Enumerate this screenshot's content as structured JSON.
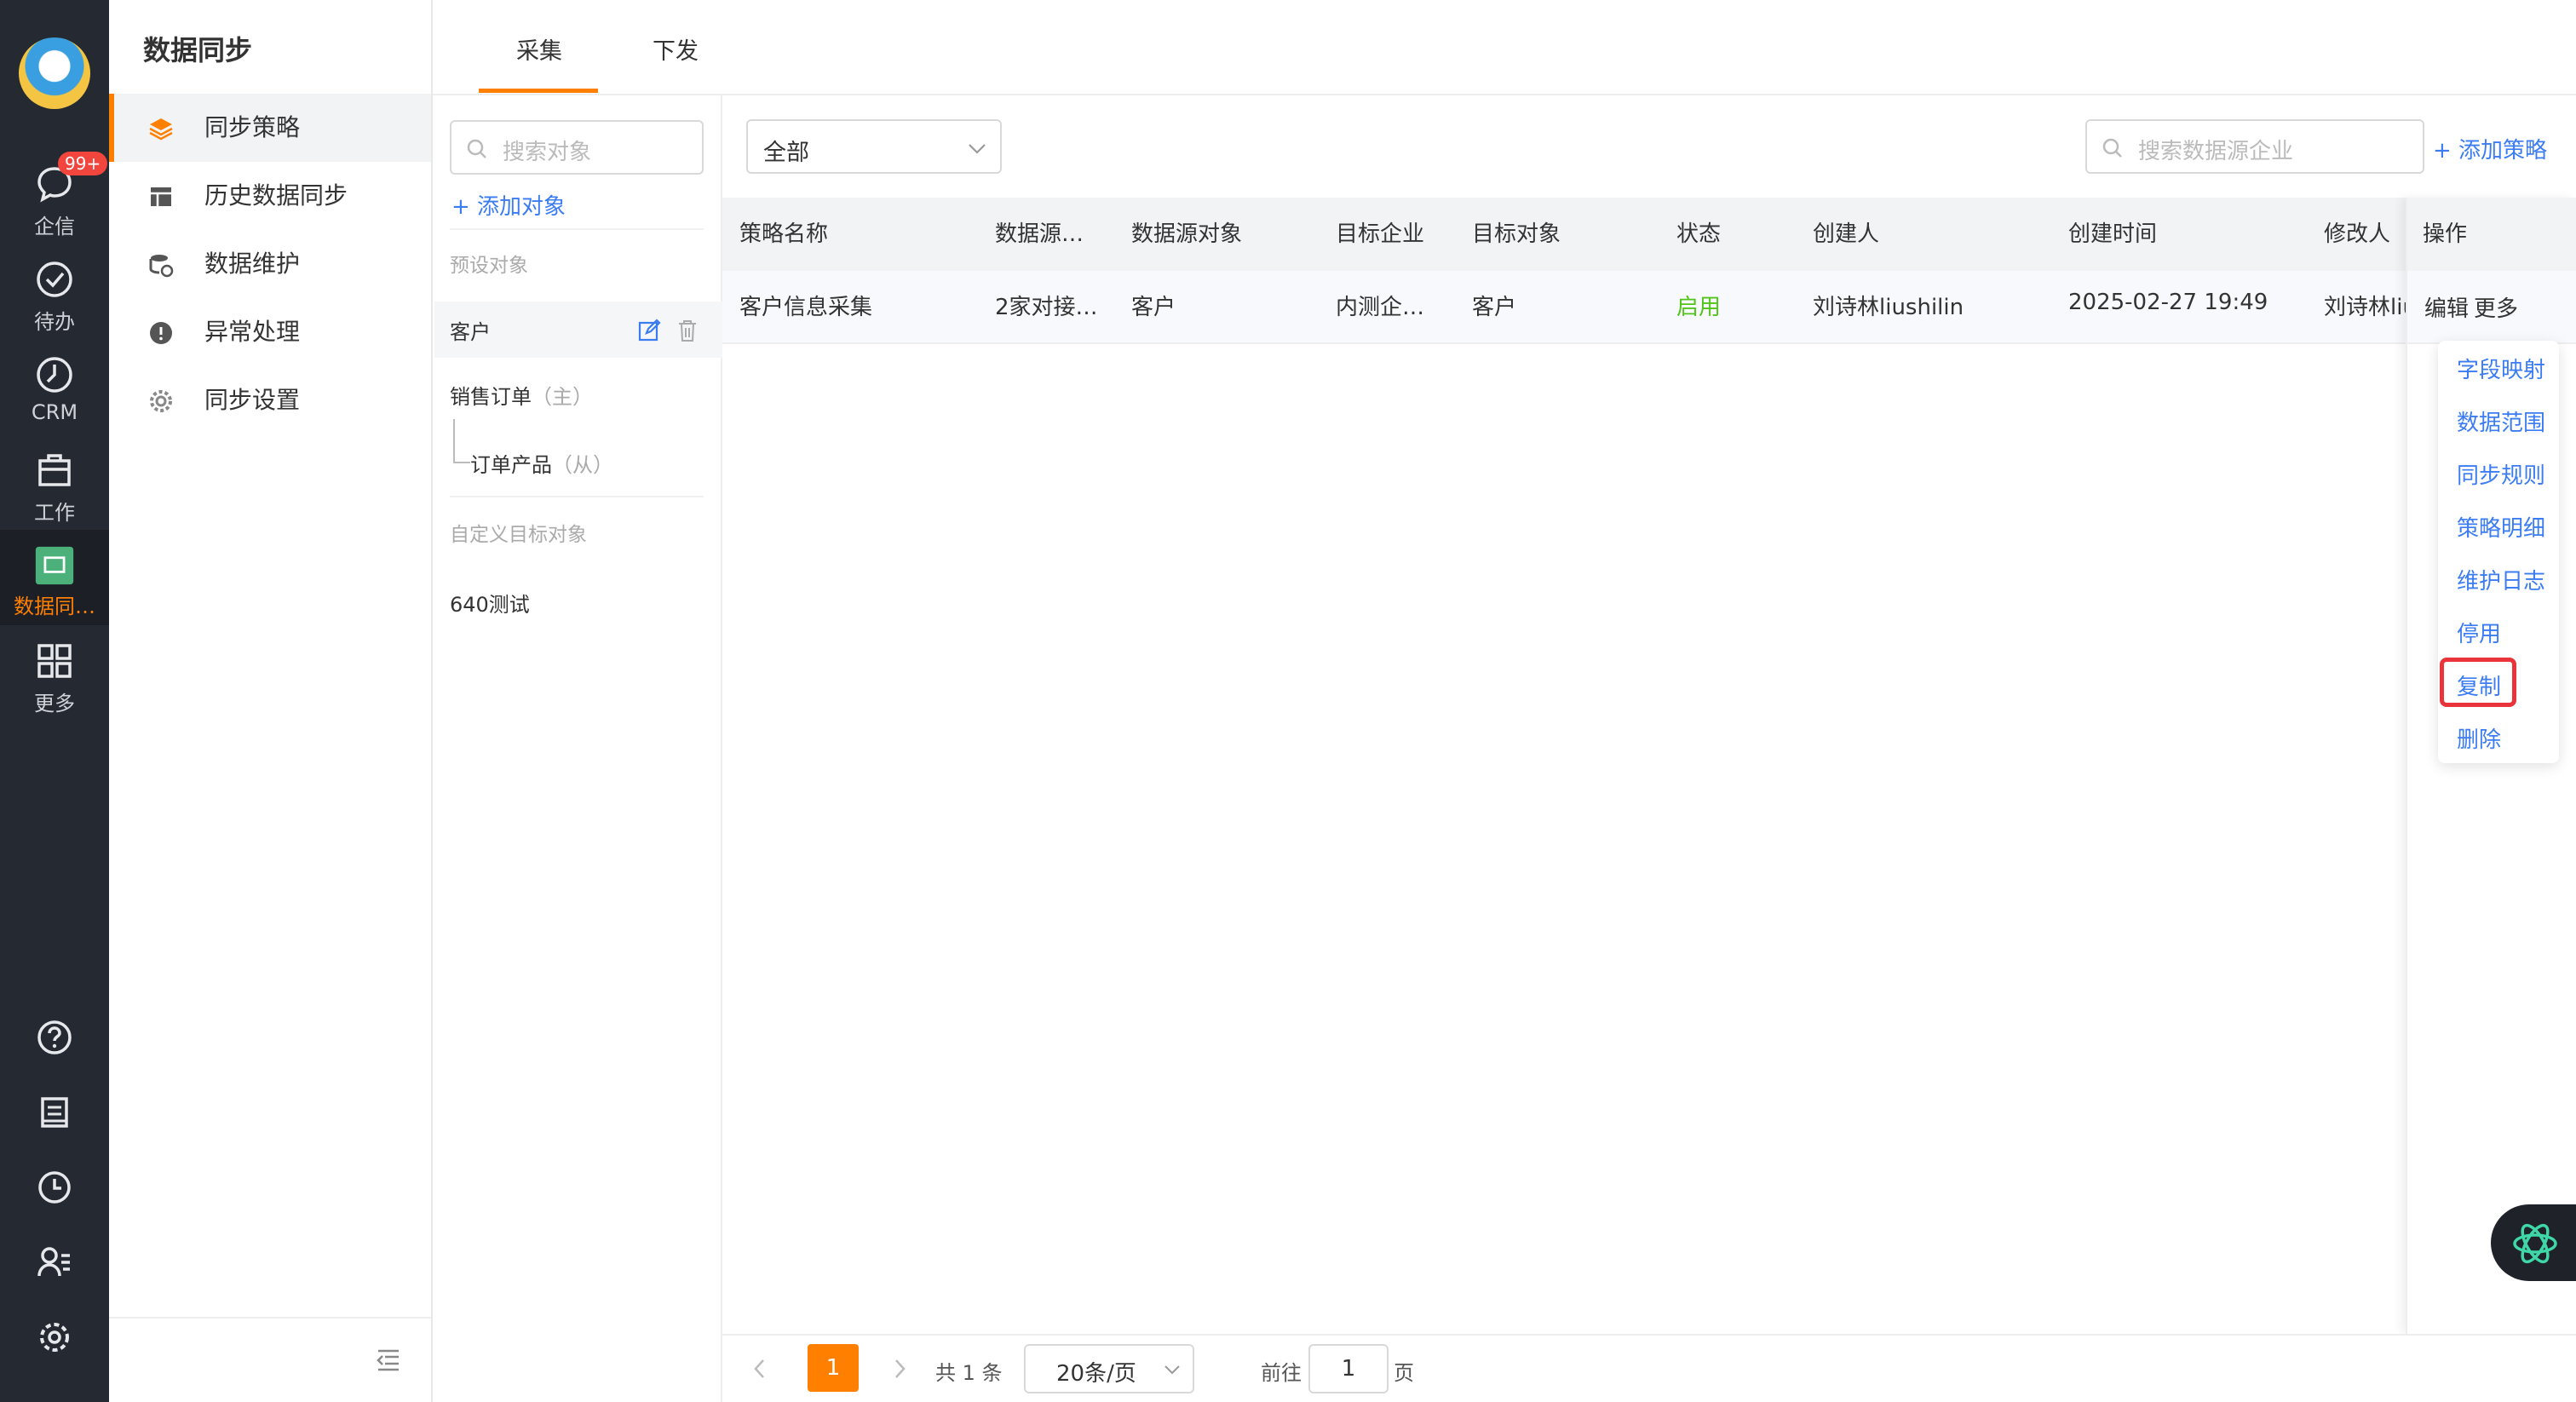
{
  "nav": {
    "items": [
      {
        "label": "企信",
        "icon": "chat-icon",
        "badge": "99+"
      },
      {
        "label": "待办",
        "icon": "check-circle-icon"
      },
      {
        "label": "CRM",
        "icon": "clock-icon"
      },
      {
        "label": "工作",
        "icon": "briefcase-icon"
      },
      {
        "label": "数据同…",
        "icon": "data-sync-app-icon"
      },
      {
        "label": "更多",
        "icon": "grid-icon"
      }
    ],
    "bottom_icons": [
      "help-icon",
      "document-icon",
      "history-icon",
      "user-list-icon",
      "settings-icon"
    ]
  },
  "sidebar": {
    "title": "数据同步",
    "items": [
      {
        "label": "同步策略",
        "icon": "layers-icon"
      },
      {
        "label": "历史数据同步",
        "icon": "table-icon"
      },
      {
        "label": "数据维护",
        "icon": "database-icon"
      },
      {
        "label": "异常处理",
        "icon": "exclamation-icon"
      },
      {
        "label": "同步设置",
        "icon": "gear-icon"
      }
    ]
  },
  "tabs": [
    {
      "label": "采集"
    },
    {
      "label": "下发"
    }
  ],
  "objects": {
    "search_placeholder": "搜索对象",
    "add_label": "+ 添加对象",
    "preset_header": "预设对象",
    "preset": [
      {
        "label": "客户"
      },
      {
        "label": "销售订单",
        "tag": "（主）"
      },
      {
        "label": "订单产品",
        "tag": "（从）"
      }
    ],
    "custom_header": "自定义目标对象",
    "custom": [
      {
        "label": "640测试"
      }
    ]
  },
  "toolbar": {
    "filter_value": "全部",
    "search_placeholder": "搜索数据源企业",
    "add_label": "+ 添加策略"
  },
  "table": {
    "headers": [
      "策略名称",
      "数据源…",
      "数据源对象",
      "目标企业",
      "目标对象",
      "状态",
      "创建人",
      "创建时间",
      "修改人",
      "操作"
    ],
    "rows": [
      {
        "name": "客户信息采集",
        "source": "2家对接…",
        "source_object": "客户",
        "target_company": "内测企…",
        "target_object": "客户",
        "status": "启用",
        "creator": "刘诗林liushilin",
        "created_at": "2025-02-27 19:49",
        "modifier": "刘诗林liu",
        "edit": "编辑",
        "more": "更多"
      }
    ]
  },
  "more_menu": [
    "字段映射",
    "数据范围",
    "同步规则",
    "策略明细",
    "维护日志",
    "停用",
    "复制",
    "删除"
  ],
  "pagination": {
    "current": "1",
    "total": "共 1 条",
    "page_size": "20条/页",
    "goto_prefix": "前往",
    "goto_value": "1",
    "goto_suffix": "页"
  },
  "colors": {
    "accent": "#ff8000",
    "link": "#3b7cf2",
    "status_green": "#52c41a",
    "highlight_red": "#e8343a",
    "nav_bg": "#252932"
  }
}
